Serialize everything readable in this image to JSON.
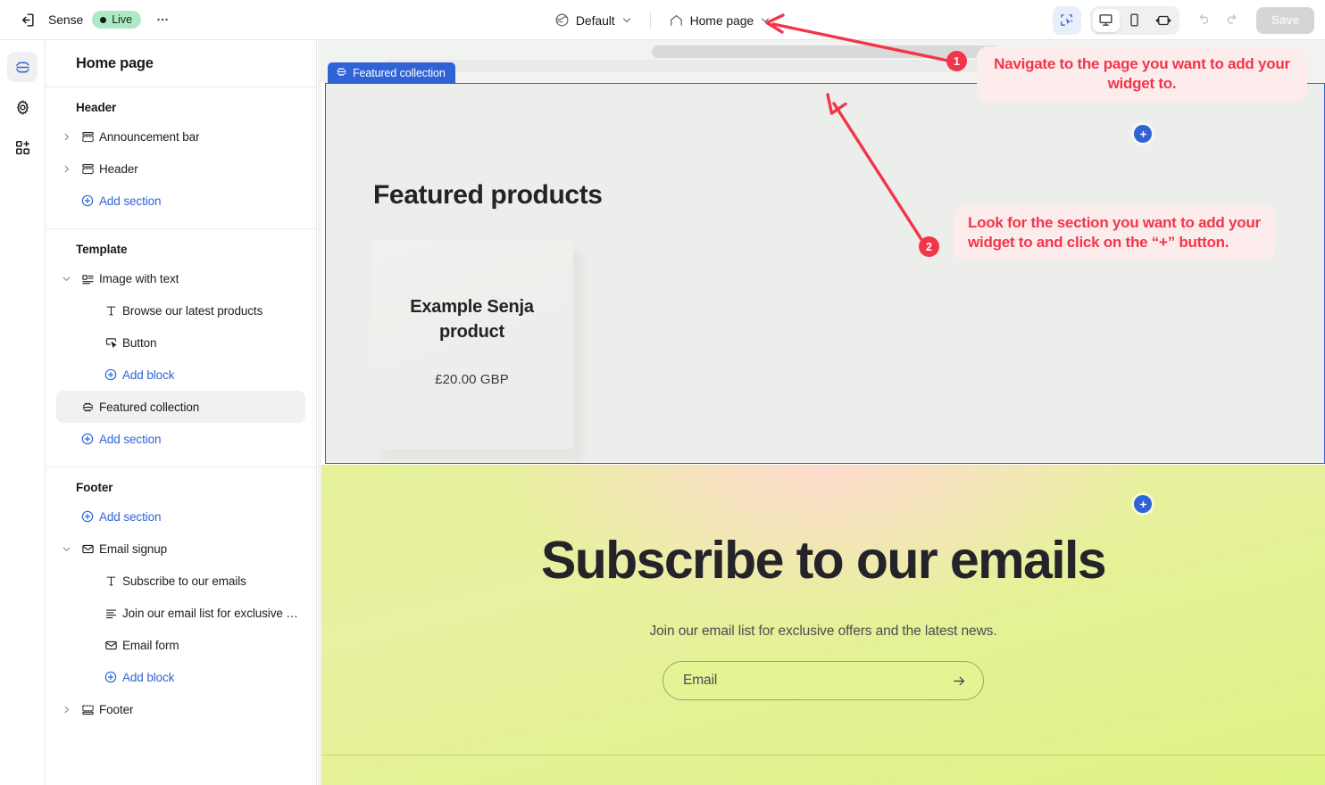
{
  "topbar": {
    "back_icon": "exit-icon",
    "shop_name": "Sense",
    "status_badge": "Live",
    "more_label": "•••",
    "theme_selector": {
      "icon": "globe-icon",
      "label": "Default"
    },
    "page_selector": {
      "icon": "home-icon",
      "label": "Home page"
    },
    "viewport_buttons": [
      {
        "name": "desktop",
        "icon": "desktop-icon",
        "active": true
      },
      {
        "name": "mobile",
        "icon": "mobile-icon",
        "active": false
      },
      {
        "name": "fullwidth",
        "icon": "fullwidth-icon",
        "active": false
      }
    ],
    "pointer_toggle_icon": "select-pointer-icon",
    "undo_label": "undo-icon",
    "redo_label": "redo-icon",
    "save_label": "Save"
  },
  "rail": {
    "items": [
      {
        "name": "sections",
        "icon": "sections-icon",
        "active": true
      },
      {
        "name": "settings",
        "icon": "gear-icon",
        "active": false
      },
      {
        "name": "apps",
        "icon": "apps-add-icon",
        "active": false
      }
    ]
  },
  "sidebar": {
    "title": "Home page",
    "groups": [
      {
        "label": "Header",
        "rows": [
          {
            "text": "Announcement bar",
            "icon": "section-icon",
            "caret": "right",
            "level": 1,
            "type": "section"
          },
          {
            "text": "Header",
            "icon": "section-icon",
            "caret": "right",
            "level": 1,
            "type": "section"
          },
          {
            "text": "Add section",
            "icon": "plus-circle-icon",
            "level": 1,
            "type": "add"
          }
        ]
      },
      {
        "label": "Template",
        "rows": [
          {
            "text": "Image with text",
            "icon": "image-text-icon",
            "caret": "down",
            "level": 1,
            "type": "section"
          },
          {
            "text": "Browse our latest products",
            "icon": "text-icon",
            "level": 2,
            "type": "block"
          },
          {
            "text": "Button",
            "icon": "button-icon",
            "level": 2,
            "type": "block"
          },
          {
            "text": "Add block",
            "icon": "plus-circle-icon",
            "level": 2,
            "type": "add"
          },
          {
            "text": "Featured collection",
            "icon": "collection-icon",
            "level": 1,
            "type": "section",
            "selected": true
          },
          {
            "text": "Add section",
            "icon": "plus-circle-icon",
            "level": 1,
            "type": "add"
          }
        ]
      },
      {
        "label": "Footer",
        "rows": [
          {
            "text": "Add section",
            "icon": "plus-circle-icon",
            "level": 1,
            "type": "add"
          },
          {
            "text": "Email signup",
            "icon": "envelope-icon",
            "caret": "down",
            "level": 1,
            "type": "section"
          },
          {
            "text": "Subscribe to our emails",
            "icon": "text-icon",
            "level": 2,
            "type": "block"
          },
          {
            "text": "Join our email list for exclusive o...",
            "icon": "paragraph-icon",
            "level": 2,
            "type": "block"
          },
          {
            "text": "Email form",
            "icon": "envelope-icon",
            "level": 2,
            "type": "block"
          },
          {
            "text": "Add block",
            "icon": "plus-circle-icon",
            "level": 2,
            "type": "add"
          },
          {
            "text": "Footer",
            "icon": "footer-icon",
            "caret": "right",
            "level": 1,
            "type": "section"
          }
        ]
      }
    ]
  },
  "canvas": {
    "section_badge": "Featured collection",
    "featured": {
      "heading": "Featured products",
      "product_name": "Example Senja product",
      "product_price": "£20.00 GBP"
    },
    "email_signup": {
      "heading": "Subscribe to our emails",
      "subheading": "Join our email list for exclusive offers and the latest news.",
      "input_placeholder": "Email",
      "submit_icon": "arrow-right-icon"
    },
    "add_section_button_label": "+"
  },
  "annotations": [
    {
      "number": "1",
      "text": "Navigate to the page you want to add your widget to."
    },
    {
      "number": "2",
      "text": "Look for the section you want to add your widget to and click on the “+” button."
    }
  ],
  "colors": {
    "accent_blue": "#2f63d6",
    "annotation_red": "#f3354a",
    "annotation_bg": "#fdecec",
    "live_green": "#aee9c5"
  }
}
